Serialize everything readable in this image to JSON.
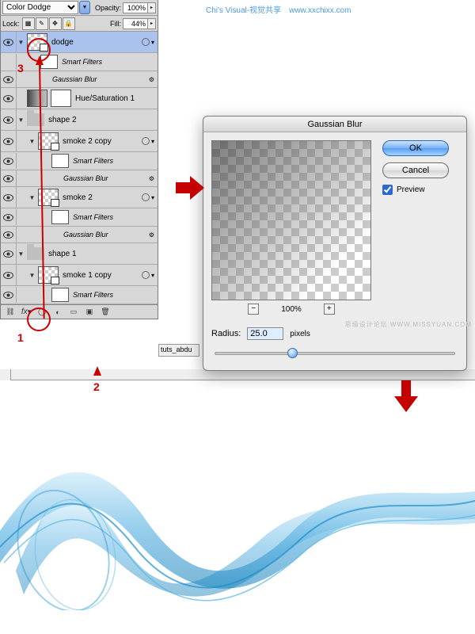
{
  "header": {
    "brand": "Chi's Visual-视觉共享",
    "url": "www.xxchixx.com"
  },
  "layers": {
    "blend_mode": "Color Dodge",
    "opacity_label": "Opacity:",
    "opacity_value": "100%",
    "lock_label": "Lock:",
    "fill_label": "Fill:",
    "fill_value": "44%",
    "items": [
      {
        "name": "dodge"
      },
      {
        "name": "Smart Filters"
      },
      {
        "name": "Gaussian Blur"
      },
      {
        "name": "Hue/Saturation 1"
      },
      {
        "name": "shape 2"
      },
      {
        "name": "smoke 2 copy"
      },
      {
        "name": "Smart Filters"
      },
      {
        "name": "Gaussian Blur"
      },
      {
        "name": "smoke 2"
      },
      {
        "name": "Smart Filters"
      },
      {
        "name": "Gaussian Blur"
      },
      {
        "name": "shape 1"
      },
      {
        "name": "smoke 1 copy"
      },
      {
        "name": "Smart Filters"
      }
    ]
  },
  "annotations": {
    "n1": "1",
    "n2": "2",
    "n3": "3"
  },
  "dialog": {
    "title": "Gaussian Blur",
    "ok": "OK",
    "cancel": "Cancel",
    "preview": "Preview",
    "zoom": "100%",
    "radius_label": "Radius:",
    "radius_value": "25.0",
    "radius_unit": "pixels"
  },
  "watermark": "思缘设计论坛  WWW.MISSYUAN.COM",
  "tab": "tuts_abdu"
}
